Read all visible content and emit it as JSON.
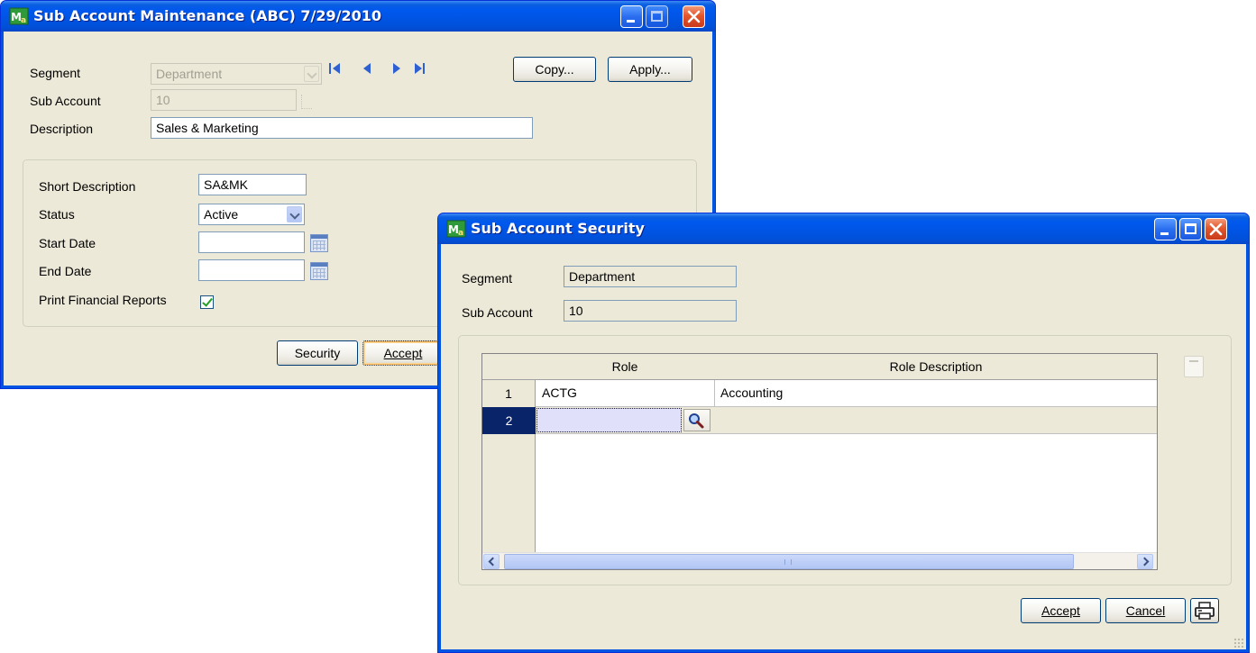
{
  "maintenance_window": {
    "title": "Sub Account Maintenance (ABC) 7/29/2010",
    "segment_label": "Segment",
    "segment_value": "Department",
    "sub_account_label": "Sub Account",
    "sub_account_value": "10",
    "description_label": "Description",
    "description_value": "Sales & Marketing",
    "copy_button": "Copy...",
    "apply_button": "Apply...",
    "short_description_label": "Short Description",
    "short_description_value": "SA&MK",
    "status_label": "Status",
    "status_value": "Active",
    "start_date_label": "Start Date",
    "start_date_value": "",
    "end_date_label": "End Date",
    "end_date_value": "",
    "print_financial_label": "Print Financial Reports",
    "print_financial_checked": true,
    "security_button": "Security",
    "accept_button": "Accept"
  },
  "security_window": {
    "title": "Sub Account Security",
    "segment_label": "Segment",
    "segment_value": "Department",
    "sub_account_label": "Sub Account",
    "sub_account_value": "10",
    "grid": {
      "columns": [
        "Role",
        "Role Description"
      ],
      "rows": [
        {
          "num": "1",
          "role": "ACTG",
          "description": "Accounting"
        },
        {
          "num": "2",
          "role": "",
          "description": ""
        }
      ]
    },
    "accept_button": "Accept",
    "cancel_button": "Cancel"
  },
  "colors": {
    "title_bar": "#0054e3",
    "window_bg": "#ece9d8",
    "selected_row": "#0a246a",
    "active_cell": "#e0e0fa"
  },
  "icons": [
    "app-icon",
    "minimize-icon",
    "maximize-icon",
    "close-icon",
    "first-record-icon",
    "previous-record-icon",
    "next-record-icon",
    "last-record-icon",
    "calendar-icon",
    "lookup-icon",
    "printer-icon"
  ]
}
